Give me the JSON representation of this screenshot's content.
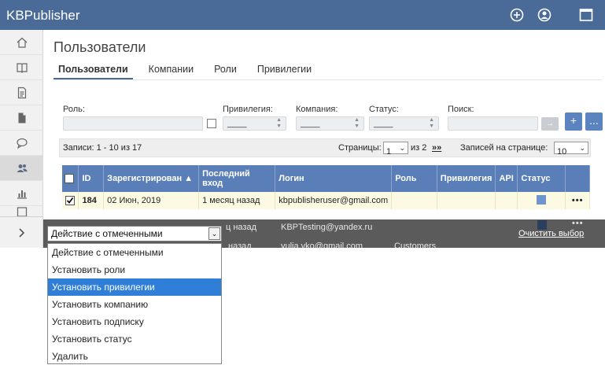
{
  "app": {
    "title": "KBPublisher"
  },
  "topbar": {
    "icons": [
      "add-circle-icon",
      "user-circle-icon",
      "window-icon"
    ]
  },
  "sidebar": {
    "items": [
      "home-icon",
      "book-icon",
      "document-icon",
      "file-icon",
      "comments-icon",
      "users-icon",
      "chart-icon",
      "template-icon"
    ],
    "active_index": 5,
    "expand_label": "›"
  },
  "page": {
    "title": "Пользователи",
    "tabs": [
      "Пользователи",
      "Компании",
      "Роли",
      "Привилегии"
    ],
    "active_tab": 0
  },
  "filters": {
    "role_label": "Роль:",
    "privilege_label": "Привилегия:",
    "privilege_value": "____",
    "company_label": "Компания:",
    "company_value": "____",
    "status_label": "Статус:",
    "status_value": "____",
    "search_label": "Поиск:",
    "go_label": "→",
    "add_label": "+",
    "more_label": "..."
  },
  "pager": {
    "records": "Записи: 1 - 10 из 17",
    "pages_label": "Страницы:",
    "page_value": "1",
    "of_pages": "из 2",
    "next": "»»",
    "per_page_label": "Записей на странице:",
    "per_page_value": "10"
  },
  "table": {
    "headers": [
      "ID",
      "Зарегистрирован ▲",
      "Последний вход",
      "Логин",
      "Роль",
      "Привилегия",
      "API",
      "Статус"
    ],
    "rows": [
      {
        "id": "184",
        "registered": "02 Июн, 2019",
        "last_login": "1 месяц назад",
        "login": "kbpublisheruser@gmail.com",
        "role": "",
        "checked": true
      },
      {
        "id": "",
        "registered": "",
        "last_login": "ц назад",
        "login": "KBPTesting@yandex.ru",
        "role": "",
        "checked": false
      },
      {
        "id": "",
        "registered": "",
        "last_login": "назад",
        "login": "yulia.vko@gmail.com",
        "role": "Customers",
        "checked": false
      }
    ]
  },
  "actions": {
    "selected": "Действие с отмеченными",
    "clear_label": "Очистить выбор",
    "options": [
      "Действие с отмеченными",
      "Установить роли",
      "Установить привилегии",
      "Установить компанию",
      "Установить подписку",
      "Установить статус",
      "Удалить"
    ],
    "highlighted_index": 2
  },
  "colors": {
    "header": "#4a6b98",
    "table_header": "#5a7fb8",
    "highlight": "#2f7ed8",
    "row_highlight": "#fdfae3"
  }
}
